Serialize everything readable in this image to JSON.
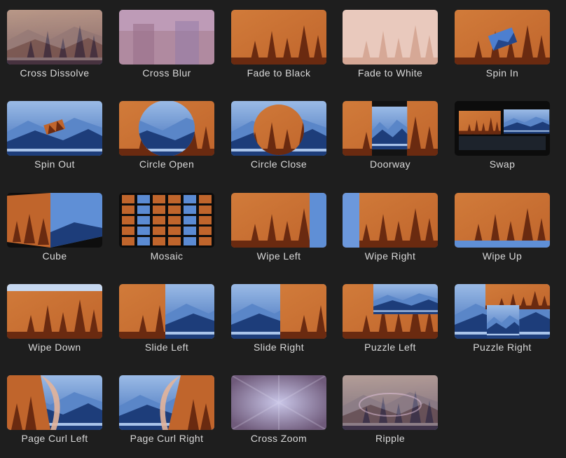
{
  "transitions": [
    {
      "label": "Cross Dissolve",
      "style": "dissolve"
    },
    {
      "label": "Cross Blur",
      "style": "blur"
    },
    {
      "label": "Fade to Black",
      "style": "orange"
    },
    {
      "label": "Fade to White",
      "style": "white"
    },
    {
      "label": "Spin In",
      "style": "spinin"
    },
    {
      "label": "Spin Out",
      "style": "spinout"
    },
    {
      "label": "Circle Open",
      "style": "circleopen"
    },
    {
      "label": "Circle Close",
      "style": "circleclose"
    },
    {
      "label": "Doorway",
      "style": "doorway"
    },
    {
      "label": "Swap",
      "style": "swap"
    },
    {
      "label": "Cube",
      "style": "cube"
    },
    {
      "label": "Mosaic",
      "style": "mosaic"
    },
    {
      "label": "Wipe Left",
      "style": "wipeleft"
    },
    {
      "label": "Wipe Right",
      "style": "wiperight"
    },
    {
      "label": "Wipe Up",
      "style": "wipeup"
    },
    {
      "label": "Wipe Down",
      "style": "wipedown"
    },
    {
      "label": "Slide Left",
      "style": "slideleft"
    },
    {
      "label": "Slide Right",
      "style": "slideright"
    },
    {
      "label": "Puzzle Left",
      "style": "puzzleleft"
    },
    {
      "label": "Puzzle Right",
      "style": "puzzleright"
    },
    {
      "label": "Page Curl Left",
      "style": "curlleft"
    },
    {
      "label": "Page Curl Right",
      "style": "curlright"
    },
    {
      "label": "Cross Zoom",
      "style": "zoom"
    },
    {
      "label": "Ripple",
      "style": "ripple"
    }
  ],
  "colors": {
    "background": "#1e1e1e",
    "label_text": "#d9d9d9",
    "forest_orange": "#c0652c",
    "forest_dark": "#6a2a10",
    "mountain_blue": "#3c6bb8",
    "mountain_dark": "#1d3d7a"
  }
}
